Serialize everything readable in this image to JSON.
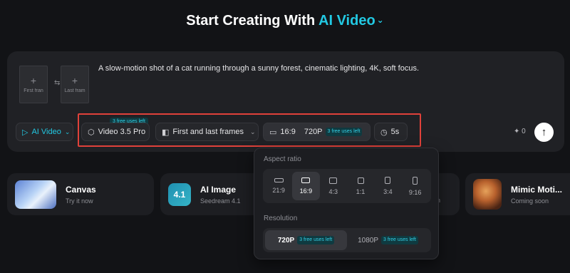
{
  "header": {
    "title_prefix": "Start Creating With",
    "title_accent": "AI Video",
    "chevron": "⌄"
  },
  "composer": {
    "first_frame_label": "First fran",
    "last_frame_label": "Last fram",
    "swap_icon": "⇆",
    "prompt": "A slow-motion shot of a cat running through a sunny forest, cinematic lighting, 4K, soft focus.",
    "mode": "AI Video",
    "model_badge": "3 free uses left",
    "model": "Video 3.5 Pro",
    "frames_mode": "First and last frames",
    "ratio": "16:9",
    "resolution": "720P",
    "resolution_badge": "3 free uses left",
    "duration": "5s",
    "credits": "✦ 0",
    "submit_icon": "↑"
  },
  "cards": [
    {
      "title": "Canvas",
      "subtitle": "Try it now"
    },
    {
      "title": "AI Image",
      "subtitle": "Seedream 4.1",
      "thumb_text": "4.1"
    },
    {
      "title": "Mimic Moti...",
      "subtitle": "Coming soon"
    }
  ],
  "card3_partial_subtitle": "n",
  "dropdown": {
    "aspect_label": "Aspect ratio",
    "ratios": [
      "21:9",
      "16:9",
      "4:3",
      "1:1",
      "3:4",
      "9:16"
    ],
    "selected_ratio": "16:9",
    "resolution_label": "Resolution",
    "resolutions": [
      {
        "label": "720P",
        "badge": "3 free uses left"
      },
      {
        "label": "1080P",
        "badge": "3 free uses left"
      }
    ],
    "selected_resolution": "720P"
  },
  "colors": {
    "accent": "#22c9e3",
    "highlight_border": "#e0413a"
  }
}
